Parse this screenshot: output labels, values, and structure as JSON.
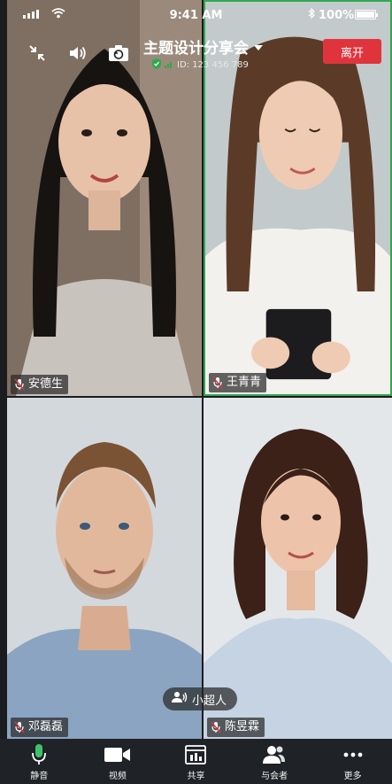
{
  "status_bar": {
    "time": "9:41 AM",
    "battery": "100%"
  },
  "meeting": {
    "title": "主题设计分享会",
    "id_text": "ID: 123 456 789",
    "leave_label": "离开"
  },
  "participants": [
    {
      "name": "安德生"
    },
    {
      "name": "王青青"
    },
    {
      "name": "邓磊磊"
    },
    {
      "name": "陈昱霖"
    }
  ],
  "speaker": {
    "label": "小超人"
  },
  "toolbar": {
    "items": [
      {
        "label": "静音",
        "icon": "mic-icon"
      },
      {
        "label": "视频",
        "icon": "video-icon"
      },
      {
        "label": "共享",
        "icon": "share-screen-icon"
      },
      {
        "label": "与会者",
        "icon": "participants-icon"
      },
      {
        "label": "更多",
        "icon": "more-icon"
      }
    ]
  },
  "colors": {
    "leave": "#e0343d",
    "active_speaker_border": "#2fa84f",
    "toolbar_bg": "#1f2226"
  }
}
